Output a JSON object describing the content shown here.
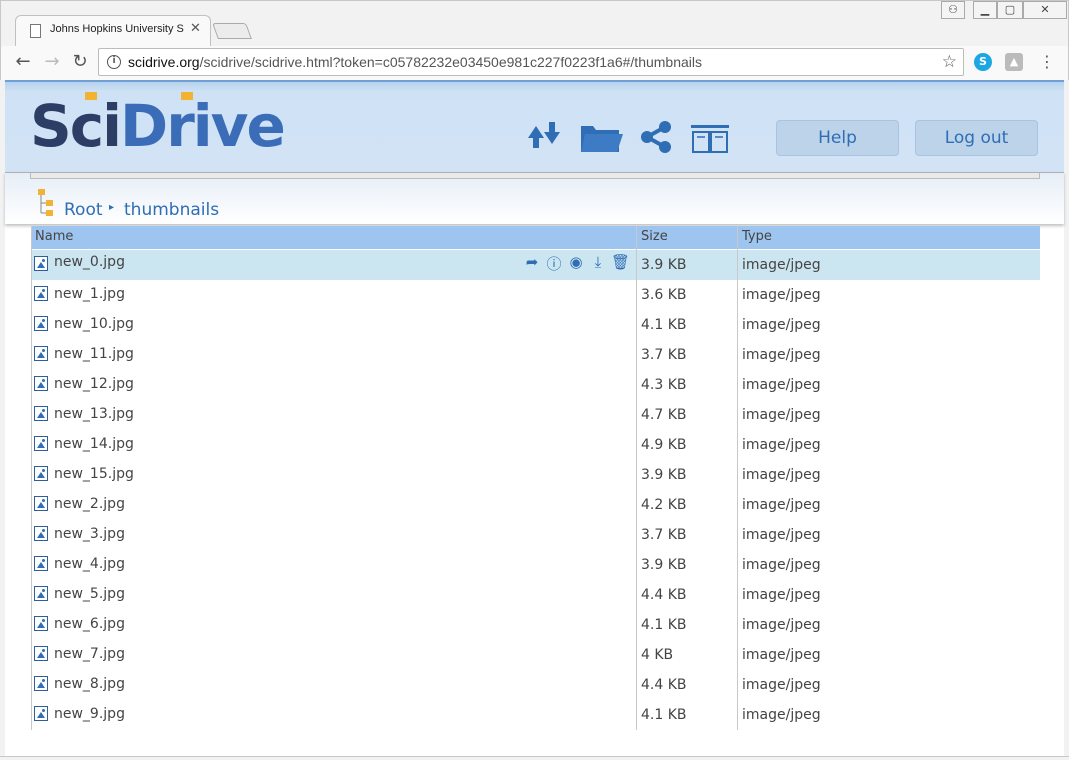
{
  "browser": {
    "tab_title": "Johns Hopkins University Sc",
    "url_host": "scidrive.org",
    "url_path": "/scidrive/scidrive.html?token=c05782232e03450e981c227f0223f1a6#/thumbnails",
    "icons": {
      "back": "back-arrow-icon",
      "forward": "forward-arrow-icon",
      "reload": "reload-icon",
      "info": "info-icon",
      "star": "star-icon",
      "skype": "skype-icon",
      "drive": "drive-icon",
      "menu": "kebab-menu-icon"
    }
  },
  "app": {
    "logo_sci": "Sci",
    "logo_drive": "Drive",
    "header_icons": [
      "sync-icon",
      "folder-icon",
      "share-icon",
      "book-icon"
    ],
    "help_label": "Help",
    "logout_label": "Log out",
    "colors": {
      "accent": "#2f6db5",
      "header_bg": "#d2e3f5",
      "table_header": "#9dc5f0",
      "selected_row": "#cbe6f0"
    }
  },
  "breadcrumb": {
    "root": "Root",
    "current": "thumbnails"
  },
  "table": {
    "columns": [
      "Name",
      "Size",
      "Type"
    ],
    "row_actions": [
      "share-icon",
      "info-icon",
      "preview-eye-icon",
      "download-icon",
      "trash-icon"
    ],
    "rows": [
      {
        "name": "new_0.jpg",
        "size": "3.9 KB",
        "type": "image/jpeg"
      },
      {
        "name": "new_1.jpg",
        "size": "3.6 KB",
        "type": "image/jpeg"
      },
      {
        "name": "new_10.jpg",
        "size": "4.1 KB",
        "type": "image/jpeg"
      },
      {
        "name": "new_11.jpg",
        "size": "3.7 KB",
        "type": "image/jpeg"
      },
      {
        "name": "new_12.jpg",
        "size": "4.3 KB",
        "type": "image/jpeg"
      },
      {
        "name": "new_13.jpg",
        "size": "4.7 KB",
        "type": "image/jpeg"
      },
      {
        "name": "new_14.jpg",
        "size": "4.9 KB",
        "type": "image/jpeg"
      },
      {
        "name": "new_15.jpg",
        "size": "3.9 KB",
        "type": "image/jpeg"
      },
      {
        "name": "new_2.jpg",
        "size": "4.2 KB",
        "type": "image/jpeg"
      },
      {
        "name": "new_3.jpg",
        "size": "3.7 KB",
        "type": "image/jpeg"
      },
      {
        "name": "new_4.jpg",
        "size": "3.9 KB",
        "type": "image/jpeg"
      },
      {
        "name": "new_5.jpg",
        "size": "4.4 KB",
        "type": "image/jpeg"
      },
      {
        "name": "new_6.jpg",
        "size": "4.1 KB",
        "type": "image/jpeg"
      },
      {
        "name": "new_7.jpg",
        "size": "4 KB",
        "type": "image/jpeg"
      },
      {
        "name": "new_8.jpg",
        "size": "4.4 KB",
        "type": "image/jpeg"
      },
      {
        "name": "new_9.jpg",
        "size": "4.1 KB",
        "type": "image/jpeg"
      }
    ]
  }
}
